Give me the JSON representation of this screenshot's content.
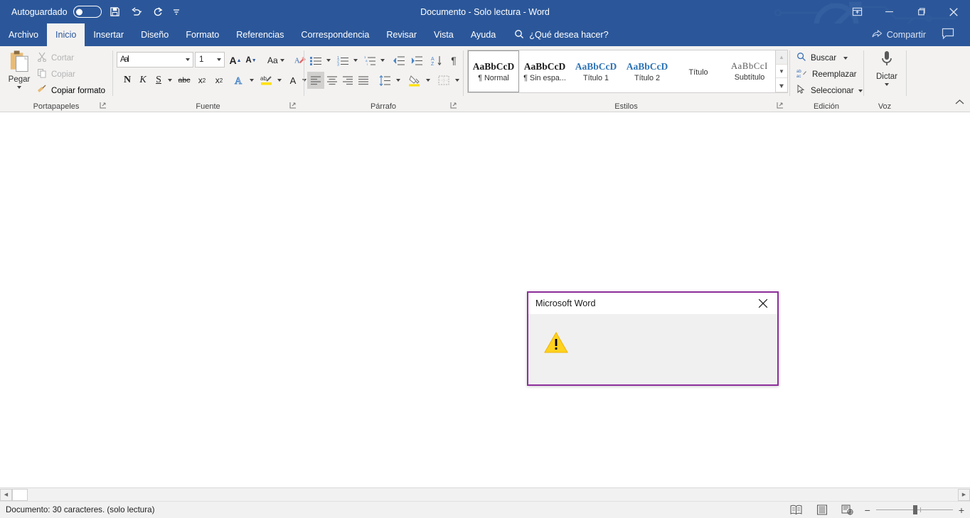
{
  "titlebar": {
    "autosave_label": "Autoguardado",
    "autosave_state": "off",
    "quick_access": [
      {
        "name": "save-icon",
        "label": "Guardar"
      },
      {
        "name": "undo-icon",
        "label": "Deshacer"
      },
      {
        "name": "redo-icon",
        "label": "Rehacer"
      },
      {
        "name": "customize-qat-icon",
        "label": "Personalizar barra de herramientas de acceso rápido"
      }
    ],
    "document_title": "Documento  -  Solo lectura  -  Word",
    "window_buttons": [
      {
        "name": "ribbon-display-options-icon",
        "label": "Opciones de presentación de la cinta de opciones"
      },
      {
        "name": "minimize-icon",
        "label": "Minimizar"
      },
      {
        "name": "maximize-icon",
        "label": "Maximizar"
      },
      {
        "name": "close-icon",
        "label": "Cerrar"
      }
    ],
    "share_label": "Compartir",
    "comment_label": "Comentarios"
  },
  "tabs": [
    {
      "label": "Archivo",
      "active": false
    },
    {
      "label": "Inicio",
      "active": true
    },
    {
      "label": "Insertar",
      "active": false
    },
    {
      "label": "Diseño",
      "active": false
    },
    {
      "label": "Formato",
      "active": false
    },
    {
      "label": "Referencias",
      "active": false
    },
    {
      "label": "Correspondencia",
      "active": false
    },
    {
      "label": "Revisar",
      "active": false
    },
    {
      "label": "Vista",
      "active": false
    },
    {
      "label": "Ayuda",
      "active": false
    }
  ],
  "tell_me": {
    "placeholder": "¿Qué desea hacer?",
    "icon": "search-icon"
  },
  "ribbon": {
    "clipboard": {
      "group_label": "Portapapeles",
      "paste_label": "Pegar",
      "cut_label": "Cortar",
      "copy_label": "Copiar",
      "format_painter_label": "Copiar formato"
    },
    "font": {
      "group_label": "Fuente",
      "font_name_value": "Aal",
      "font_size_value": "1",
      "buttons": [
        {
          "name": "grow-font-icon",
          "label": "A"
        },
        {
          "name": "shrink-font-icon",
          "label": "A"
        },
        {
          "name": "change-case-icon",
          "label": "Aa"
        },
        {
          "name": "clear-formatting-icon",
          "label": "Borrar formato"
        },
        {
          "name": "bold-icon",
          "label": "N"
        },
        {
          "name": "italic-icon",
          "label": "K"
        },
        {
          "name": "underline-icon",
          "label": "S"
        },
        {
          "name": "strikethrough-icon",
          "label": "abc"
        },
        {
          "name": "subscript-icon",
          "label": "x₂"
        },
        {
          "name": "superscript-icon",
          "label": "x²"
        },
        {
          "name": "text-effects-icon",
          "label": "A"
        },
        {
          "name": "text-highlight-icon",
          "label": "ab"
        },
        {
          "name": "font-color-icon",
          "label": "A"
        }
      ]
    },
    "paragraph": {
      "group_label": "Párrafo",
      "buttons": [
        {
          "name": "bullets-icon",
          "label": "Viñetas"
        },
        {
          "name": "numbering-icon",
          "label": "Numeración"
        },
        {
          "name": "multilevel-list-icon",
          "label": "Lista multinivel"
        },
        {
          "name": "decrease-indent-icon",
          "label": "Disminuir sangría"
        },
        {
          "name": "increase-indent-icon",
          "label": "Aumentar sangría"
        },
        {
          "name": "sort-icon",
          "label": "Ordenar"
        },
        {
          "name": "show-formatting-marks-icon",
          "label": "Mostrar todo"
        },
        {
          "name": "align-left-icon",
          "label": "Alinear a la izquierda"
        },
        {
          "name": "align-center-icon",
          "label": "Centrar"
        },
        {
          "name": "align-right-icon",
          "label": "Alinear a la derecha"
        },
        {
          "name": "justify-icon",
          "label": "Justificar"
        },
        {
          "name": "line-spacing-icon",
          "label": "Espaciado"
        },
        {
          "name": "shading-icon",
          "label": "Sombreado"
        },
        {
          "name": "borders-icon",
          "label": "Bordes"
        }
      ]
    },
    "styles": {
      "group_label": "Estilos",
      "items": [
        {
          "preview": "AaBbCcD",
          "name": "¶ Normal",
          "kind": "normal",
          "selected": true
        },
        {
          "preview": "AaBbCcD",
          "name": "¶ Sin espa...",
          "kind": "normal",
          "selected": false
        },
        {
          "preview": "AaBbCcD",
          "name": "Título 1",
          "kind": "heading",
          "selected": false
        },
        {
          "preview": "AaBbCcD",
          "name": "Título 2",
          "kind": "heading",
          "selected": false
        },
        {
          "preview": "",
          "name": "Título",
          "kind": "blank",
          "selected": false
        },
        {
          "preview": "AaBbCcI",
          "name": "Subtítulo",
          "kind": "subtitle",
          "selected": false
        }
      ],
      "scroll_up": "scroll-up-icon",
      "scroll_down": "scroll-down-icon",
      "more": "more-styles-icon"
    },
    "editing": {
      "group_label": "Edición",
      "find_label": "Buscar",
      "replace_label": "Reemplazar",
      "select_label": "Seleccionar"
    },
    "voice": {
      "group_label": "Voz",
      "dictate_label": "Dictar"
    },
    "collapse_label": "Contraer la cinta de opciones"
  },
  "dialog": {
    "title": "Microsoft Word",
    "close_label": "Cerrar",
    "icon": "warning-triangle-icon",
    "message": "",
    "border_color": "#8e2f9c",
    "body_color": "#f0f0f0",
    "warning_color": "#ffd21e"
  },
  "statusbar": {
    "text": "Documento: 30 caracteres. (solo lectura)",
    "views": [
      {
        "name": "read-mode-view-icon",
        "label": "Modo de lectura"
      },
      {
        "name": "print-layout-view-icon",
        "label": "Diseño de impresión"
      },
      {
        "name": "web-layout-view-icon",
        "label": "Diseño web"
      }
    ],
    "zoom_out": "−",
    "zoom_in": "+"
  },
  "scrollbar": {
    "left_arrow": "scroll-left-icon",
    "right_arrow": "scroll-right-icon"
  },
  "theme": {
    "accent": "#2b579a",
    "ribbon_bg": "#f3f2f1",
    "heading_blue": "#2e74b5"
  }
}
